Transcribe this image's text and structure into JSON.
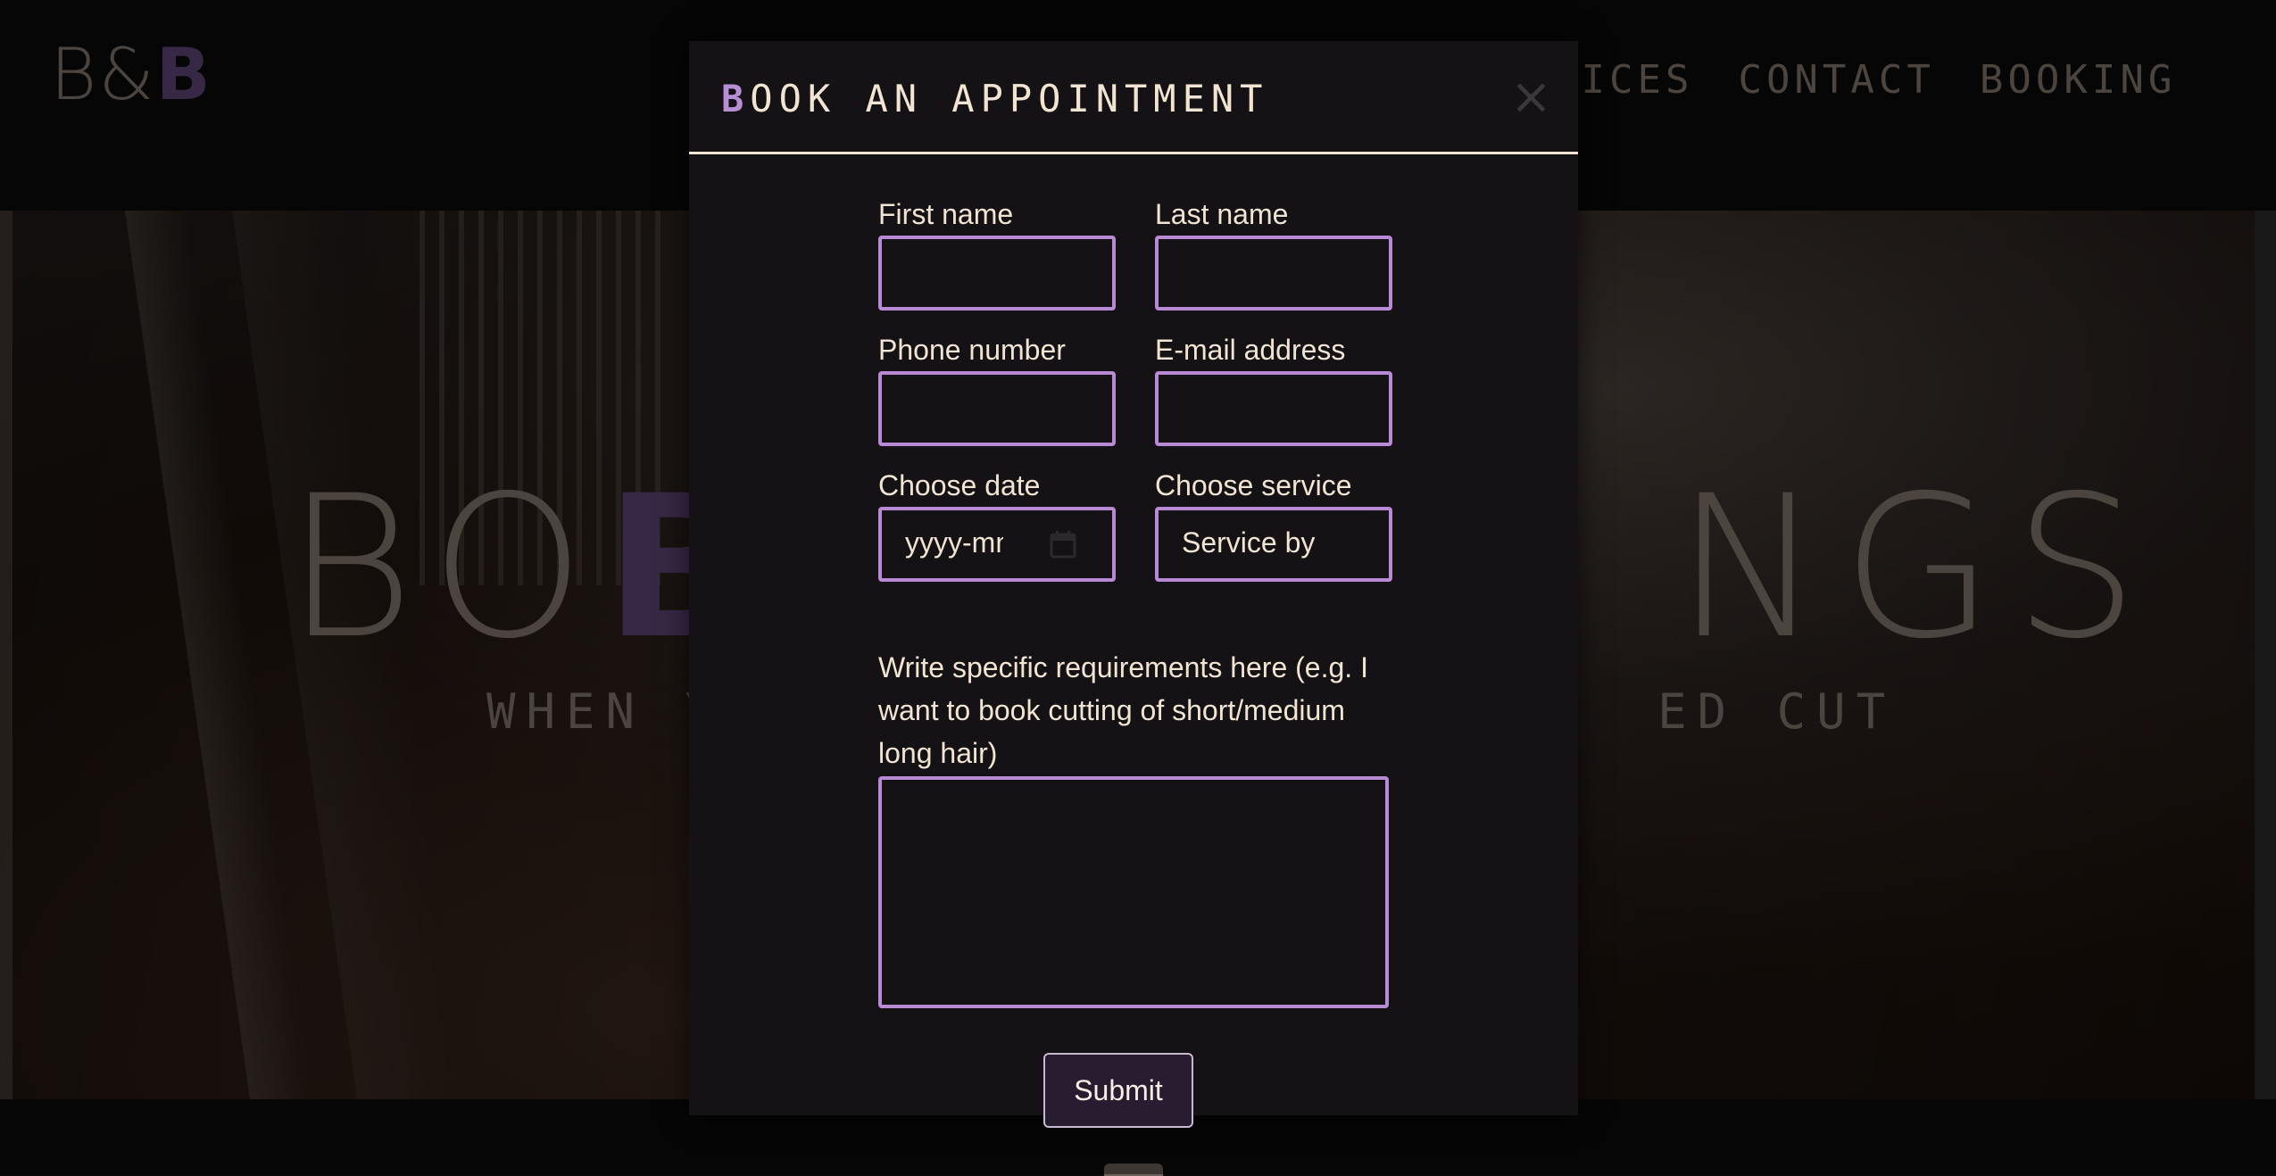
{
  "header": {
    "logo": {
      "left": "B&",
      "right": "B"
    },
    "nav": [
      "VICES",
      "CONTACT",
      "BOOKING"
    ]
  },
  "hero": {
    "title_left": "BO",
    "title_purple": "B",
    "title_right": "NGS",
    "subtitle_left": "WHEN Y",
    "subtitle_right": "ED CUT"
  },
  "modal": {
    "title_accent": "B",
    "title_rest": "OOK AN APPOINTMENT",
    "close_glyph": "×",
    "fields": {
      "first_name_label": "First name",
      "last_name_label": "Last name",
      "phone_label": "Phone number",
      "email_label": "E-mail address",
      "date_label": "Choose date",
      "date_placeholder": "yyyy-mm",
      "service_label": "Choose service",
      "service_value": "Service by",
      "requirements_label": "Write specific requirements here (e.g. I want to book cutting of short/medium long hair)"
    },
    "submit_label": "Submit"
  },
  "colors": {
    "accent_purple": "#b88ad6",
    "brand_purple": "#654a7e",
    "cream_text": "#f1e4d2",
    "muted_text": "#8a7f74"
  },
  "icons": [
    "calendar-icon",
    "close-icon"
  ]
}
